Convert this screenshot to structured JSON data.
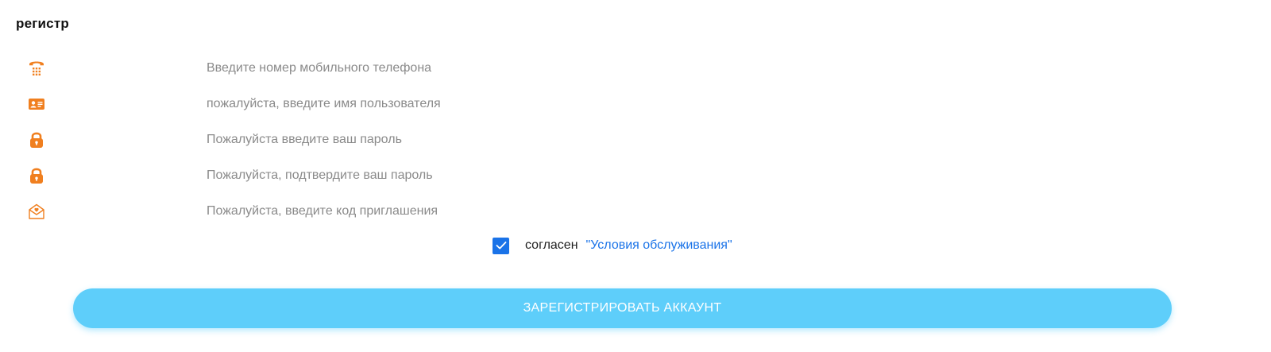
{
  "page": {
    "title": "регистр"
  },
  "form": {
    "fields": [
      {
        "icon": "phone-keypad-icon",
        "placeholder": "Введите номер мобильного телефона",
        "value": ""
      },
      {
        "icon": "id-card-icon",
        "placeholder": "пожалуйста, введите имя пользователя",
        "value": ""
      },
      {
        "icon": "lock-icon",
        "placeholder": "Пожалуйста введите ваш пароль",
        "value": ""
      },
      {
        "icon": "lock-icon",
        "placeholder": "Пожалуйста, подтвердите ваш пароль",
        "value": ""
      },
      {
        "icon": "invite-envelope-icon",
        "placeholder": "Пожалуйста, введите код приглашения",
        "value": ""
      }
    ],
    "agreement": {
      "checked": true,
      "text": "согласен",
      "link_text": "\"Условия обслуживания\""
    },
    "submit_label": "ЗАРЕГИСТРИРОВАТЬ АККАУНТ"
  },
  "colors": {
    "icon": "#f07f1f",
    "accent": "#1a73e8",
    "button": "#5ecefa"
  }
}
